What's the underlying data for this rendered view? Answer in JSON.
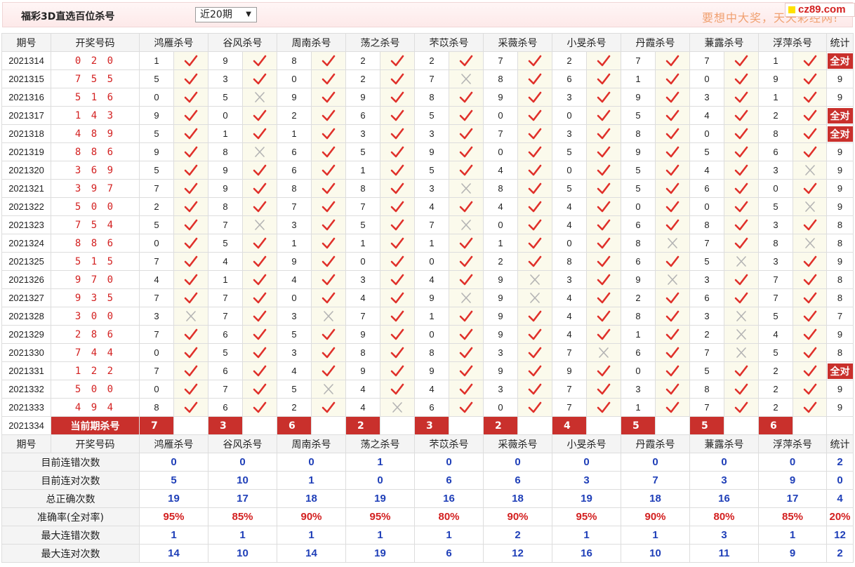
{
  "header": {
    "title": "福彩3D直选百位杀号",
    "period_select": "近20期",
    "slogan": "要想中大奖，天天彩经网!",
    "site_logo": "cz89.com"
  },
  "columns": {
    "period": "期号",
    "numbers": "开奖号码",
    "experts": [
      "鸿雁杀号",
      "谷风杀号",
      "周南杀号",
      "荡之杀号",
      "芣苡杀号",
      "采薇杀号",
      "小旻杀号",
      "丹霞杀号",
      "蒹露杀号",
      "浮萍杀号"
    ],
    "stat": "统计"
  },
  "rows": [
    {
      "period": "2021314",
      "numbers": "0 2 0",
      "kills": [
        "1",
        "9",
        "8",
        "2",
        "2",
        "7",
        "2",
        "7",
        "7",
        "1"
      ],
      "results": [
        "right",
        "right",
        "right",
        "right",
        "right",
        "right",
        "right",
        "right",
        "right",
        "right"
      ],
      "stat": "全对"
    },
    {
      "period": "2021315",
      "numbers": "7 5 5",
      "kills": [
        "5",
        "3",
        "0",
        "2",
        "7",
        "8",
        "6",
        "1",
        "0",
        "9"
      ],
      "results": [
        "right",
        "right",
        "right",
        "right",
        "wrong",
        "right",
        "right",
        "right",
        "right",
        "right"
      ],
      "stat": "9"
    },
    {
      "period": "2021316",
      "numbers": "5 1 6",
      "kills": [
        "0",
        "5",
        "9",
        "9",
        "8",
        "9",
        "3",
        "9",
        "3",
        "1"
      ],
      "results": [
        "right",
        "wrong",
        "right",
        "right",
        "right",
        "right",
        "right",
        "right",
        "right",
        "right"
      ],
      "stat": "9"
    },
    {
      "period": "2021317",
      "numbers": "1 4 3",
      "kills": [
        "9",
        "0",
        "2",
        "6",
        "5",
        "0",
        "0",
        "5",
        "4",
        "2"
      ],
      "results": [
        "right",
        "right",
        "right",
        "right",
        "right",
        "right",
        "right",
        "right",
        "right",
        "right"
      ],
      "stat": "全对"
    },
    {
      "period": "2021318",
      "numbers": "4 8 9",
      "kills": [
        "5",
        "1",
        "1",
        "3",
        "3",
        "7",
        "3",
        "8",
        "0",
        "8"
      ],
      "results": [
        "right",
        "right",
        "right",
        "right",
        "right",
        "right",
        "right",
        "right",
        "right",
        "right"
      ],
      "stat": "全对"
    },
    {
      "period": "2021319",
      "numbers": "8 8 6",
      "kills": [
        "9",
        "8",
        "6",
        "5",
        "9",
        "0",
        "5",
        "9",
        "5",
        "6"
      ],
      "results": [
        "right",
        "wrong",
        "right",
        "right",
        "right",
        "right",
        "right",
        "right",
        "right",
        "right"
      ],
      "stat": "9"
    },
    {
      "period": "2021320",
      "numbers": "3 6 9",
      "kills": [
        "5",
        "9",
        "6",
        "1",
        "5",
        "4",
        "0",
        "5",
        "4",
        "3"
      ],
      "results": [
        "right",
        "right",
        "right",
        "right",
        "right",
        "right",
        "right",
        "right",
        "right",
        "wrong"
      ],
      "stat": "9"
    },
    {
      "period": "2021321",
      "numbers": "3 9 7",
      "kills": [
        "7",
        "9",
        "8",
        "8",
        "3",
        "8",
        "5",
        "5",
        "6",
        "0"
      ],
      "results": [
        "right",
        "right",
        "right",
        "right",
        "wrong",
        "right",
        "right",
        "right",
        "right",
        "right"
      ],
      "stat": "9"
    },
    {
      "period": "2021322",
      "numbers": "5 0 0",
      "kills": [
        "2",
        "8",
        "7",
        "7",
        "4",
        "4",
        "4",
        "0",
        "0",
        "5"
      ],
      "results": [
        "right",
        "right",
        "right",
        "right",
        "right",
        "right",
        "right",
        "right",
        "right",
        "wrong"
      ],
      "stat": "9"
    },
    {
      "period": "2021323",
      "numbers": "7 5 4",
      "kills": [
        "5",
        "7",
        "3",
        "5",
        "7",
        "0",
        "4",
        "6",
        "8",
        "3"
      ],
      "results": [
        "right",
        "wrong",
        "right",
        "right",
        "wrong",
        "right",
        "right",
        "right",
        "right",
        "right"
      ],
      "stat": "8"
    },
    {
      "period": "2021324",
      "numbers": "8 8 6",
      "kills": [
        "0",
        "5",
        "1",
        "1",
        "1",
        "1",
        "0",
        "8",
        "7",
        "8"
      ],
      "results": [
        "right",
        "right",
        "right",
        "right",
        "right",
        "right",
        "right",
        "wrong",
        "right",
        "wrong"
      ],
      "stat": "8"
    },
    {
      "period": "2021325",
      "numbers": "5 1 5",
      "kills": [
        "7",
        "4",
        "9",
        "0",
        "0",
        "2",
        "8",
        "6",
        "5",
        "3"
      ],
      "results": [
        "right",
        "right",
        "right",
        "right",
        "right",
        "right",
        "right",
        "right",
        "wrong",
        "right"
      ],
      "stat": "9"
    },
    {
      "period": "2021326",
      "numbers": "9 7 0",
      "kills": [
        "4",
        "1",
        "4",
        "3",
        "4",
        "9",
        "3",
        "9",
        "3",
        "7"
      ],
      "results": [
        "right",
        "right",
        "right",
        "right",
        "right",
        "wrong",
        "right",
        "wrong",
        "right",
        "right"
      ],
      "stat": "8"
    },
    {
      "period": "2021327",
      "numbers": "9 3 5",
      "kills": [
        "7",
        "7",
        "0",
        "4",
        "9",
        "9",
        "4",
        "2",
        "6",
        "7"
      ],
      "results": [
        "right",
        "right",
        "right",
        "right",
        "wrong",
        "wrong",
        "right",
        "right",
        "right",
        "right"
      ],
      "stat": "8"
    },
    {
      "period": "2021328",
      "numbers": "3 0 0",
      "kills": [
        "3",
        "7",
        "3",
        "7",
        "1",
        "9",
        "4",
        "8",
        "3",
        "5"
      ],
      "results": [
        "wrong",
        "right",
        "wrong",
        "right",
        "right",
        "right",
        "right",
        "right",
        "wrong",
        "right"
      ],
      "stat": "7"
    },
    {
      "period": "2021329",
      "numbers": "2 8 6",
      "kills": [
        "7",
        "6",
        "5",
        "9",
        "0",
        "9",
        "4",
        "1",
        "2",
        "4"
      ],
      "results": [
        "right",
        "right",
        "right",
        "right",
        "right",
        "right",
        "right",
        "right",
        "wrong",
        "right"
      ],
      "stat": "9"
    },
    {
      "period": "2021330",
      "numbers": "7 4 4",
      "kills": [
        "0",
        "5",
        "3",
        "8",
        "8",
        "3",
        "7",
        "6",
        "7",
        "5"
      ],
      "results": [
        "right",
        "right",
        "right",
        "right",
        "right",
        "right",
        "wrong",
        "right",
        "wrong",
        "right"
      ],
      "stat": "8"
    },
    {
      "period": "2021331",
      "numbers": "1 2 2",
      "kills": [
        "7",
        "6",
        "4",
        "9",
        "9",
        "9",
        "9",
        "0",
        "5",
        "2"
      ],
      "results": [
        "right",
        "right",
        "right",
        "right",
        "right",
        "right",
        "right",
        "right",
        "right",
        "right"
      ],
      "stat": "全对"
    },
    {
      "period": "2021332",
      "numbers": "5 0 0",
      "kills": [
        "0",
        "7",
        "5",
        "4",
        "4",
        "3",
        "7",
        "3",
        "8",
        "2"
      ],
      "results": [
        "right",
        "right",
        "wrong",
        "right",
        "right",
        "right",
        "right",
        "right",
        "right",
        "right"
      ],
      "stat": "9"
    },
    {
      "period": "2021333",
      "numbers": "4 9 4",
      "kills": [
        "8",
        "6",
        "2",
        "4",
        "6",
        "0",
        "7",
        "1",
        "7",
        "2"
      ],
      "results": [
        "right",
        "right",
        "right",
        "wrong",
        "right",
        "right",
        "right",
        "right",
        "right",
        "right"
      ],
      "stat": "9"
    }
  ],
  "current": {
    "period": "2021334",
    "label": "当前期杀号",
    "kills": [
      "7",
      "3",
      "6",
      "2",
      "3",
      "2",
      "4",
      "5",
      "5",
      "6"
    ]
  },
  "summary": [
    {
      "label": "目前连错次数",
      "values": [
        "0",
        "0",
        "0",
        "1",
        "0",
        "0",
        "0",
        "0",
        "0",
        "0"
      ],
      "stat": "2",
      "style": "val"
    },
    {
      "label": "目前连对次数",
      "values": [
        "5",
        "10",
        "1",
        "0",
        "6",
        "6",
        "3",
        "7",
        "3",
        "9"
      ],
      "stat": "0",
      "style": "val"
    },
    {
      "label": "总正确次数",
      "values": [
        "19",
        "17",
        "18",
        "19",
        "16",
        "18",
        "19",
        "18",
        "16",
        "17"
      ],
      "stat": "4",
      "style": "val"
    },
    {
      "label": "准确率(全对率)",
      "values": [
        "95%",
        "85%",
        "90%",
        "95%",
        "80%",
        "90%",
        "95%",
        "90%",
        "80%",
        "85%"
      ],
      "stat": "20%",
      "style": "pct"
    },
    {
      "label": "最大连错次数",
      "values": [
        "1",
        "1",
        "1",
        "1",
        "1",
        "2",
        "1",
        "1",
        "3",
        "1"
      ],
      "stat": "12",
      "style": "val"
    },
    {
      "label": "最大连对次数",
      "values": [
        "14",
        "10",
        "14",
        "19",
        "6",
        "12",
        "16",
        "10",
        "11",
        "9"
      ],
      "stat": "2",
      "style": "val"
    }
  ],
  "colors": {
    "accent_red": "#c9302c",
    "check_red": "#e0302a",
    "cross_grey": "#b4b4b4",
    "summary_blue": "#1f3fb8",
    "slogan": "#f0a070"
  },
  "icons": {
    "right": "check-icon",
    "wrong": "cross-icon"
  }
}
